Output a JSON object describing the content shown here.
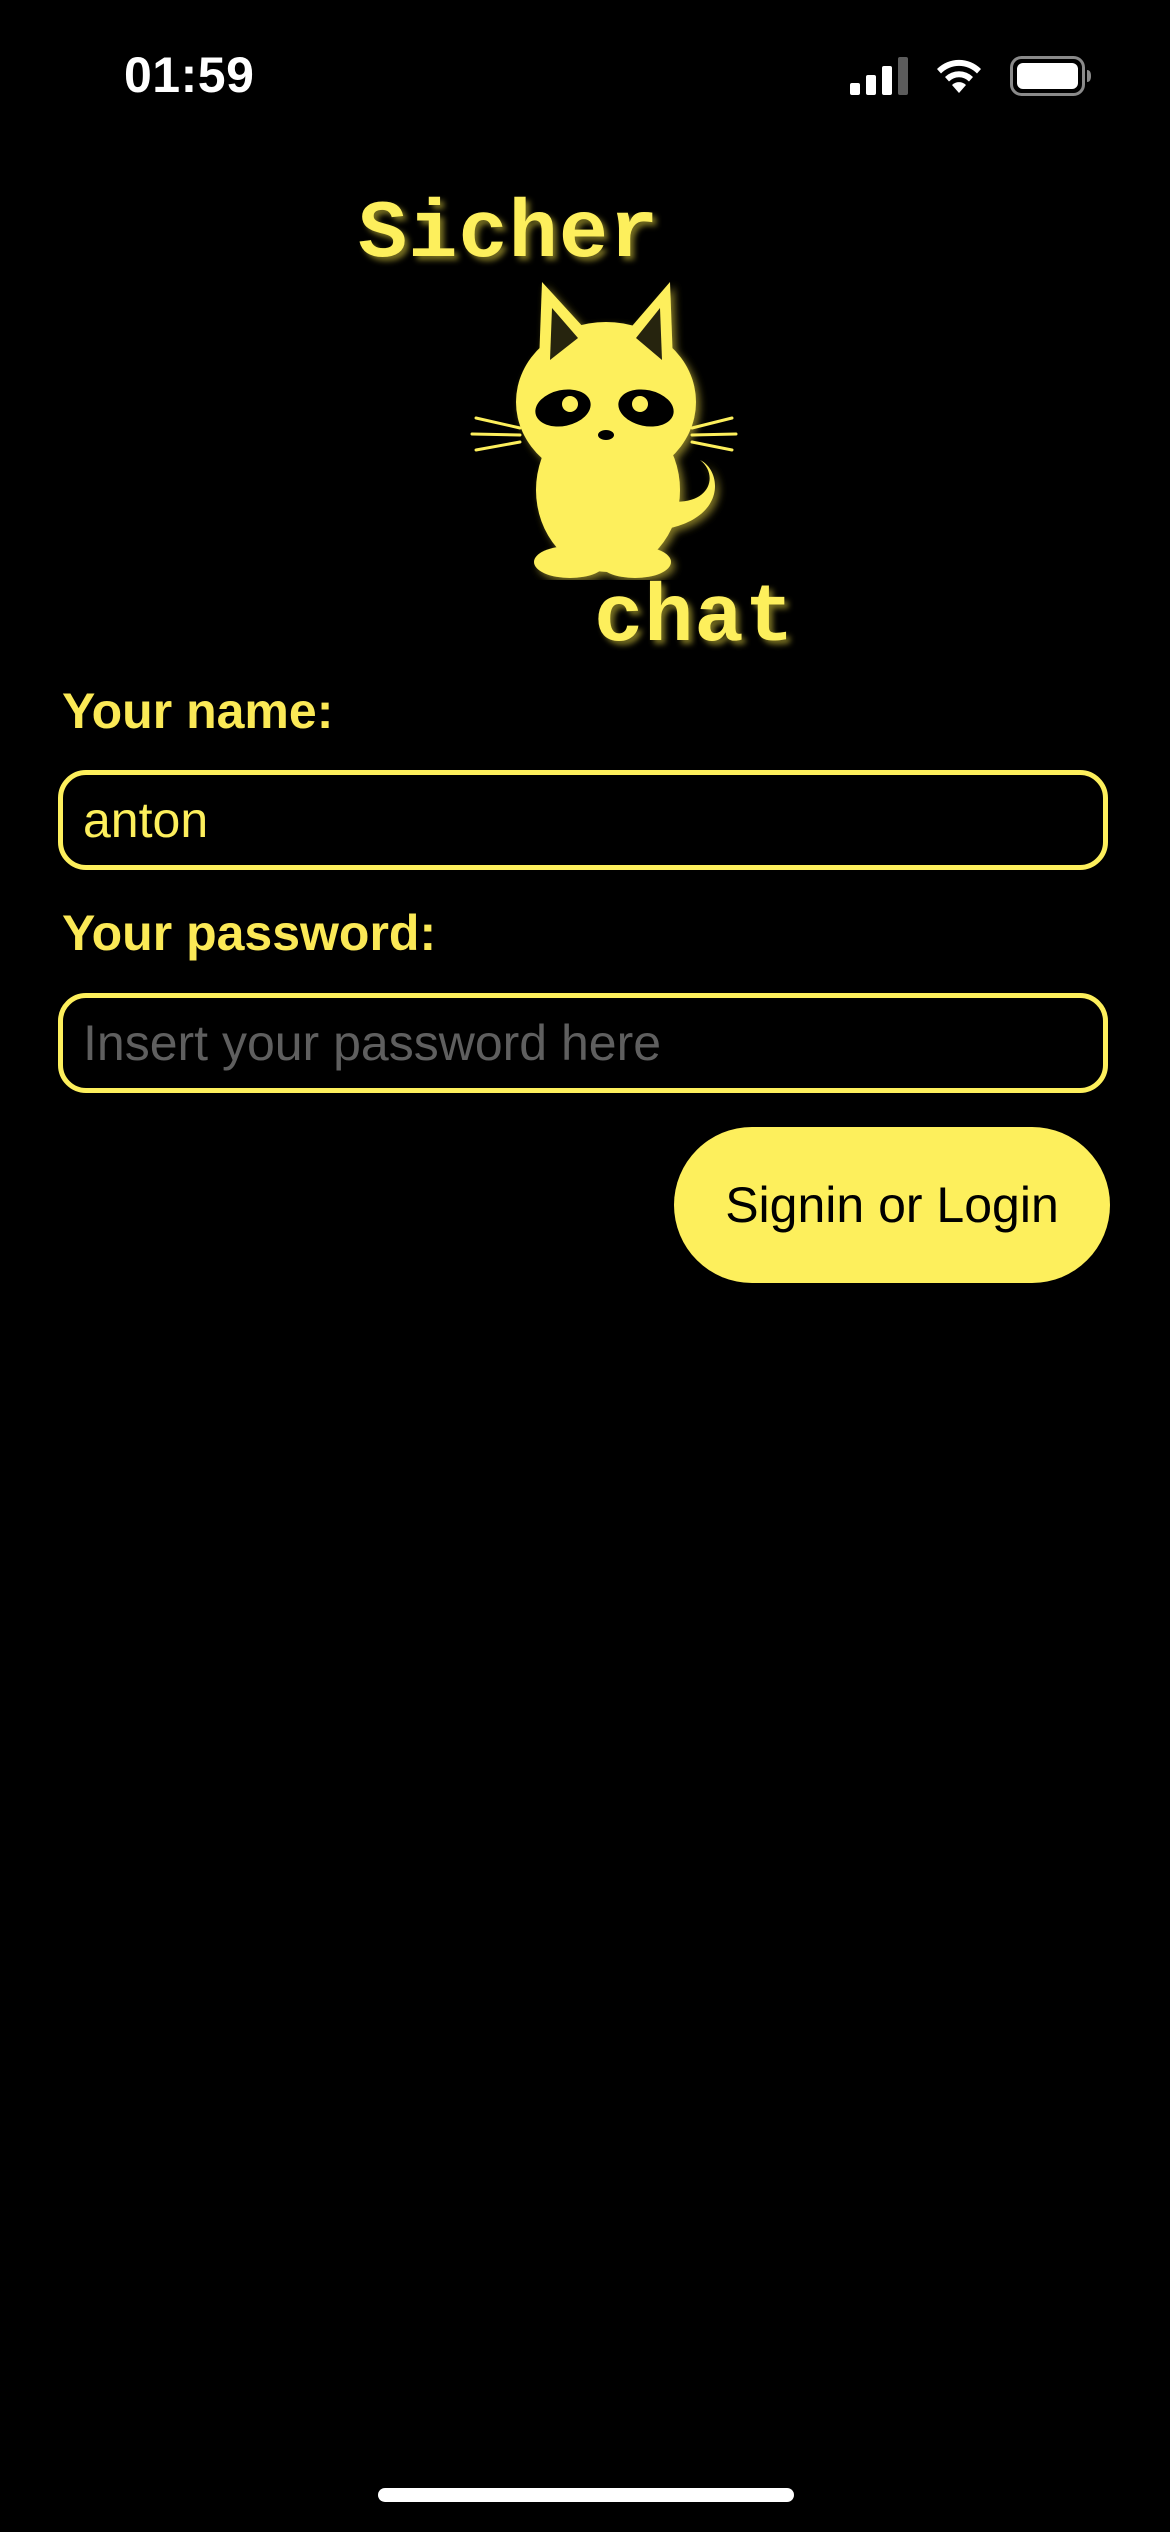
{
  "status_bar": {
    "time": "01:59",
    "icons": [
      "cellular-signal-icon",
      "wifi-icon",
      "battery-icon"
    ]
  },
  "logo": {
    "top_text": "Sicher",
    "bottom_text": "chat",
    "icon": "cat-icon"
  },
  "form": {
    "name_label": "Your name:",
    "name_value": "anton",
    "password_label": "Your password:",
    "password_value": "",
    "password_placeholder": "Insert your password here",
    "submit_label": "Signin or Login"
  },
  "colors": {
    "background": "#000000",
    "accent": "#fdef5c",
    "placeholder": "#5f5f5f"
  }
}
